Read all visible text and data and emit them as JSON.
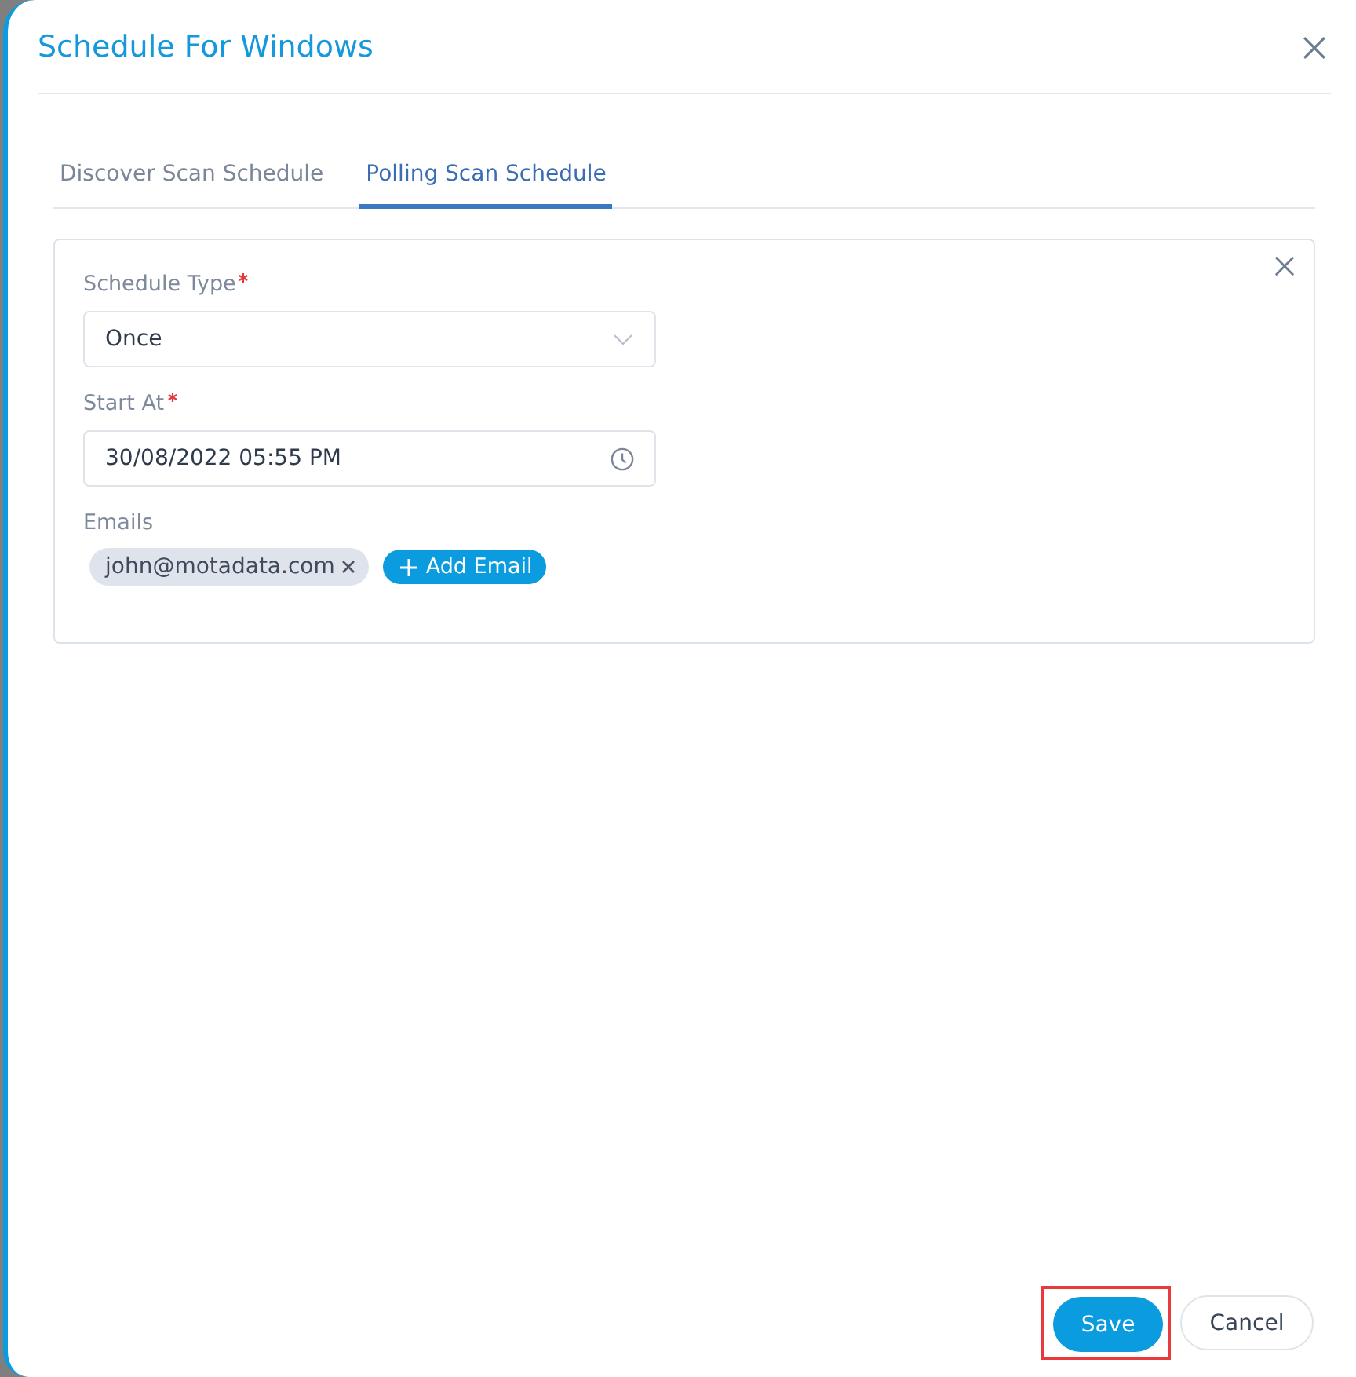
{
  "dialog": {
    "title": "Schedule For Windows"
  },
  "tabs": [
    {
      "label": "Discover Scan Schedule",
      "selected": false
    },
    {
      "label": "Polling Scan Schedule",
      "selected": true
    }
  ],
  "form": {
    "fields": [
      {
        "kind": "select",
        "label": "Schedule Type",
        "required": true,
        "value": "Once"
      },
      {
        "kind": "datetime",
        "label": "Start At",
        "required": true,
        "value": "30/08/2022 05:55 PM"
      },
      {
        "kind": "emails",
        "label": "Emails",
        "required": false,
        "chips": [
          "john@motadata.com"
        ],
        "add_label": "Add Email"
      }
    ]
  },
  "buttons": [
    {
      "label": "Save",
      "kind": "primary",
      "highlighted": true
    },
    {
      "label": "Cancel",
      "kind": "secondary",
      "highlighted": false
    }
  ]
}
